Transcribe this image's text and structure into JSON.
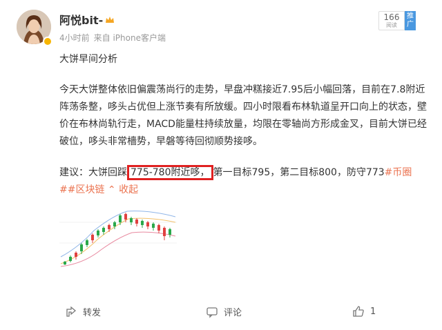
{
  "post": {
    "author": "阿悦bit-",
    "time": "4小时前",
    "source": "来自 iPhone客户端",
    "read_count": "166",
    "read_label": "阅读",
    "promo": "推广",
    "title": "大饼早间分析",
    "paragraph": "今天大饼整体依旧偏震荡尚行的走势，早盘冲糕接近7.95后小幅回落，目前在7.8附近阵荡条整，哆头占优但上涨节奏有所放缓。四小时限看布林轨道呈开口向上的状态，壁价在布林尚轨行走，MACD能量柱持续放量，均限在零轴尚方形成金叉，目前大饼已经破位，哆头非常檣势，早磐等待回彻顺势接哆。",
    "suggest_prefix": "建议：大饼回踩",
    "suggest_highlight": "775-780附近哆，",
    "suggest_rest": "第一目标795，第二目标800，防守773",
    "tag1": "#币圈",
    "tag2": "##区块链",
    "collapse": "收起"
  },
  "actions": {
    "repost": "转发",
    "comment": "评论",
    "like_count": "1"
  },
  "colors": {
    "link": "#eb7350",
    "highlight_box": "#e02020",
    "candle_up": "#2aa84a",
    "candle_down": "#e04040"
  },
  "icons": [
    "avatar",
    "verified-badge-icon",
    "crown-icon",
    "repost-icon",
    "comment-icon",
    "like-icon"
  ]
}
